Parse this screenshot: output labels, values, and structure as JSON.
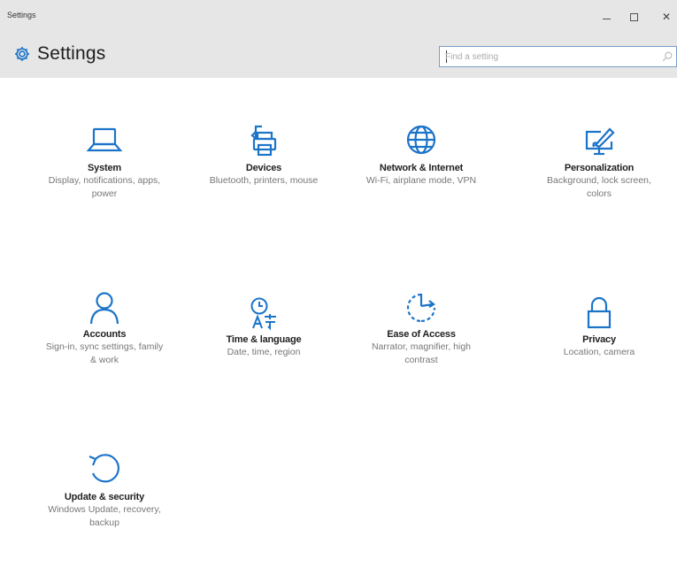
{
  "window": {
    "title": "Settings",
    "minimize_glyph": "–",
    "maximize_glyph": "□",
    "close_glyph": "✕"
  },
  "header": {
    "icon": "gear-icon",
    "title": "Settings",
    "search": {
      "placeholder": "Find a setting",
      "value": "",
      "icon": "search-icon"
    }
  },
  "accent_color": "#1c74c9",
  "tiles": [
    {
      "name": "System",
      "desc": "Display, notifications, apps, power",
      "icon": "laptop-icon"
    },
    {
      "name": "Devices",
      "desc": "Bluetooth, printers, mouse",
      "icon": "printer-icon"
    },
    {
      "name": "Network & Internet",
      "desc": "Wi-Fi, airplane mode, VPN",
      "icon": "globe-icon"
    },
    {
      "name": "Personalization",
      "desc": "Background, lock screen, colors",
      "icon": "paintbrush-icon"
    },
    {
      "name": "Accounts",
      "desc": "Sign-in, sync settings, family & work",
      "icon": "person-icon"
    },
    {
      "name": "Time & language",
      "desc": "Date, time, region",
      "icon": "clock-language-icon"
    },
    {
      "name": "Ease of Access",
      "desc": "Narrator, magnifier, high contrast",
      "icon": "ease-of-access-icon"
    },
    {
      "name": "Privacy",
      "desc": "Location, camera",
      "icon": "lock-icon"
    },
    {
      "name": "Update & security",
      "desc": "Windows Update, recovery, backup",
      "icon": "refresh-icon"
    }
  ]
}
